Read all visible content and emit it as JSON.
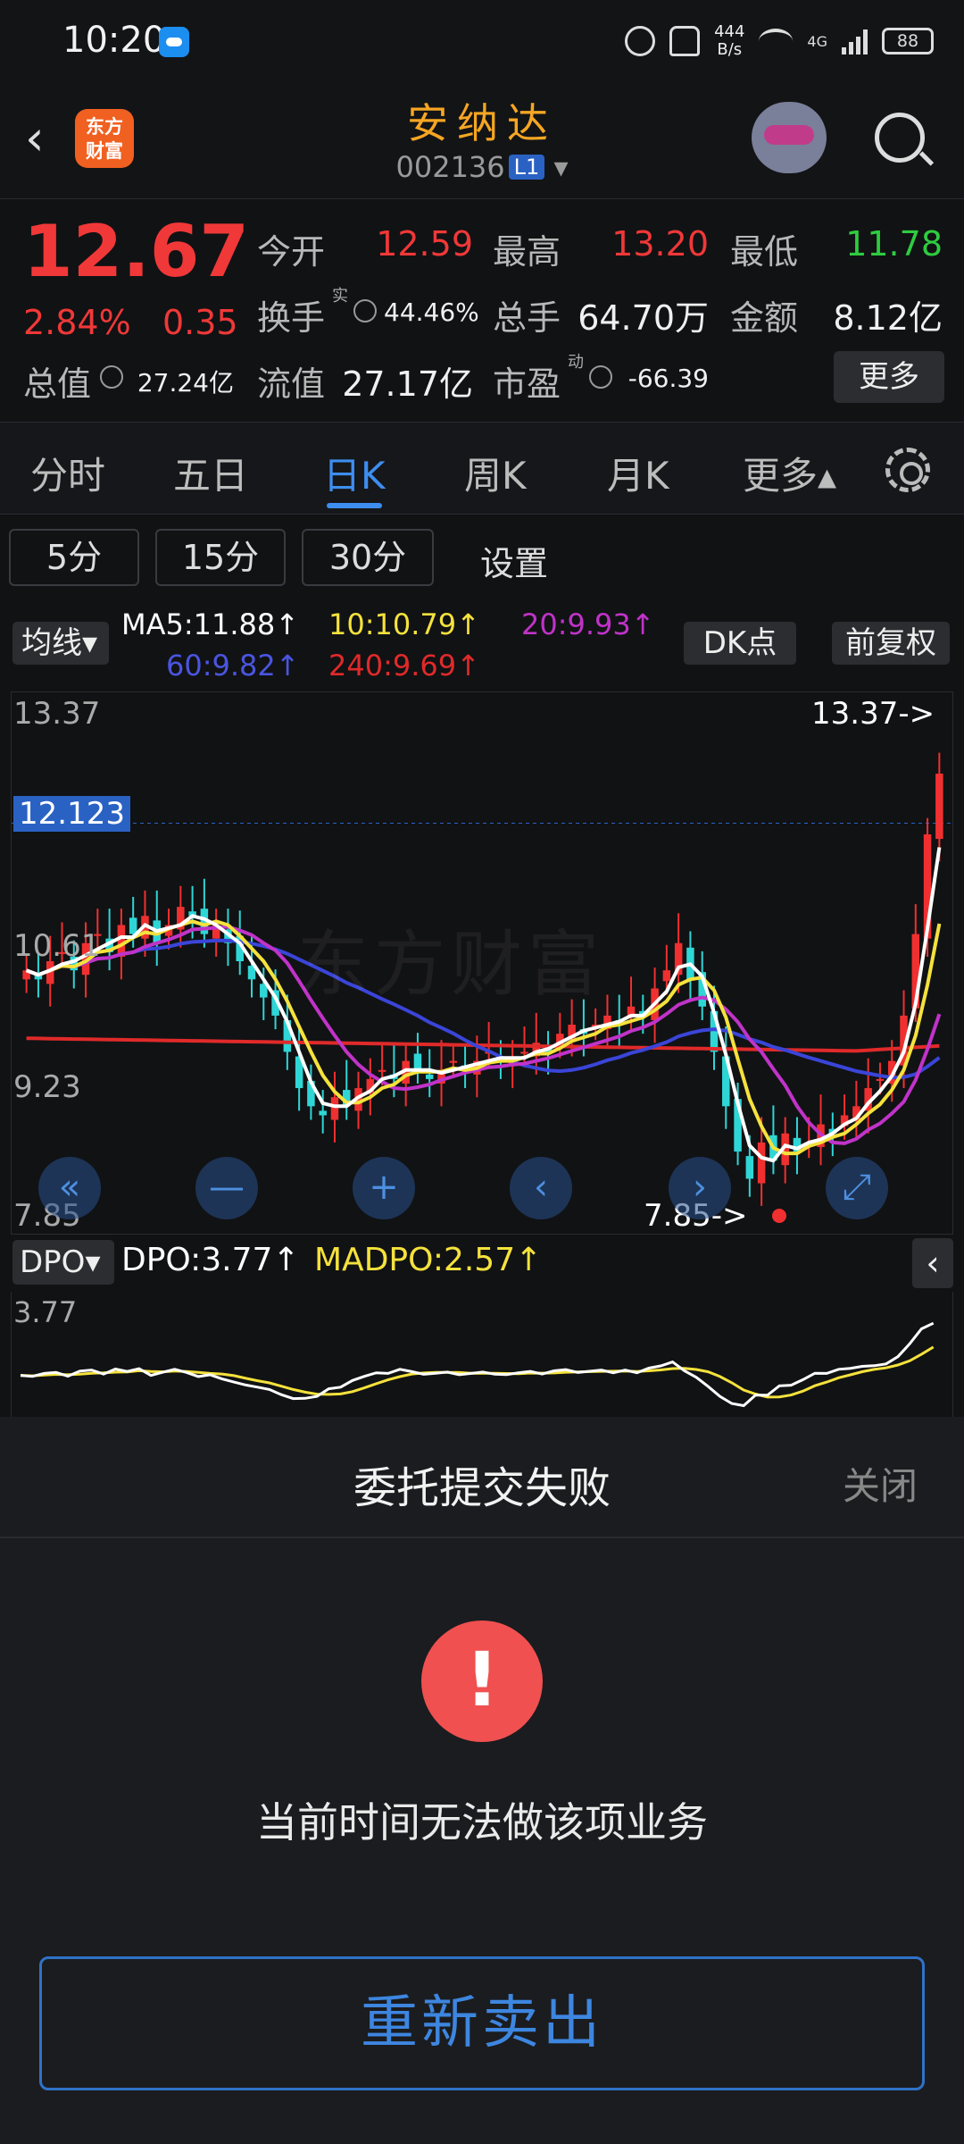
{
  "status_bar": {
    "time": "10:20",
    "net_speed_value": "444",
    "net_speed_unit": "B/s",
    "signal_label": "4G",
    "battery": "88"
  },
  "header": {
    "back_label": "‹",
    "logo_line1": "东方",
    "logo_line2": "财富",
    "stock_name": "安纳达",
    "stock_code": "002136",
    "level_badge": "L1",
    "dropdown": "▾"
  },
  "quote": {
    "price": "12.67",
    "change_pct": "2.84%",
    "change_abs": "0.35",
    "open_label": "今开",
    "open": "12.59",
    "high_label": "最高",
    "high": "13.20",
    "low_label": "最低",
    "low": "11.78",
    "turnover_label": "换手",
    "turnover_sup": "实",
    "turnover": "44.46%",
    "volume_label": "总手",
    "volume": "64.70万",
    "amount_label": "金额",
    "amount": "8.12亿",
    "mktcap_label": "总值",
    "mktcap": "27.24亿",
    "float_label": "流值",
    "float_cap": "27.17亿",
    "pe_label": "市盈",
    "pe_sup": "动",
    "pe": "-66.39",
    "more_label": "更多"
  },
  "tabs": [
    "分时",
    "五日",
    "日K",
    "周K",
    "月K",
    "更多▴"
  ],
  "minute_buttons": [
    "5分",
    "15分",
    "30分"
  ],
  "settings_label": "设置",
  "ma": {
    "select_label": "均线▾",
    "ma5": "MA5:11.88↑",
    "ma10": "10:10.79↑",
    "ma20": "20:9.93↑",
    "ma60": "60:9.82↑",
    "ma240": "240:9.69↑",
    "dk_label": "DK点",
    "fq_label": "前复权",
    "colors": {
      "ma5": "#ffffff",
      "ma10": "#f5e23c",
      "ma20": "#c033c8",
      "ma60": "#3a45d8",
      "ma240": "#e02a2a"
    }
  },
  "chart": {
    "y_high": "13.37",
    "y_mid": "10.61",
    "y_lo2": "9.23",
    "y_low": "7.85",
    "current_price_tag": "12.123",
    "max_note": "13.37->",
    "min_note": "7.85->",
    "watermark": "东方财富",
    "controls": [
      "«",
      "—",
      "+",
      "‹",
      "›",
      "⤢"
    ]
  },
  "chart_data": {
    "type": "candlestick",
    "ylim": [
      7.85,
      13.37
    ],
    "close": [
      10.5,
      10.4,
      10.6,
      10.7,
      10.5,
      10.8,
      10.9,
      10.7,
      11.0,
      10.9,
      11.1,
      10.8,
      11.0,
      11.2,
      11.1,
      10.9,
      11.0,
      10.8,
      10.6,
      10.4,
      10.2,
      10.0,
      9.6,
      9.2,
      9.0,
      8.9,
      9.1,
      9.0,
      9.2,
      9.3,
      9.4,
      9.3,
      9.5,
      9.4,
      9.3,
      9.4,
      9.5,
      9.4,
      9.5,
      9.6,
      9.5,
      9.5,
      9.6,
      9.7,
      9.6,
      9.8,
      9.9,
      9.8,
      9.9,
      10.0,
      9.9,
      10.1,
      10.0,
      10.3,
      10.5,
      10.8,
      10.4,
      10.1,
      9.6,
      9.0,
      8.5,
      8.2,
      8.6,
      8.4,
      8.7,
      8.5,
      8.6,
      8.8,
      8.7,
      8.9,
      9.0,
      9.2,
      9.3,
      9.5,
      10.0,
      10.9,
      12.0,
      12.67
    ]
  },
  "dpo": {
    "select_label": "DPO▾",
    "dpo": "DPO:3.77↑",
    "madpo": "MADPO:2.57↑",
    "top_value": "3.77",
    "collapse": "‹"
  },
  "sheet": {
    "title": "委托提交失败",
    "close_label": "关闭",
    "alert_glyph": "!",
    "message": "当前时间无法做该项业务",
    "button_label": "重新卖出"
  }
}
